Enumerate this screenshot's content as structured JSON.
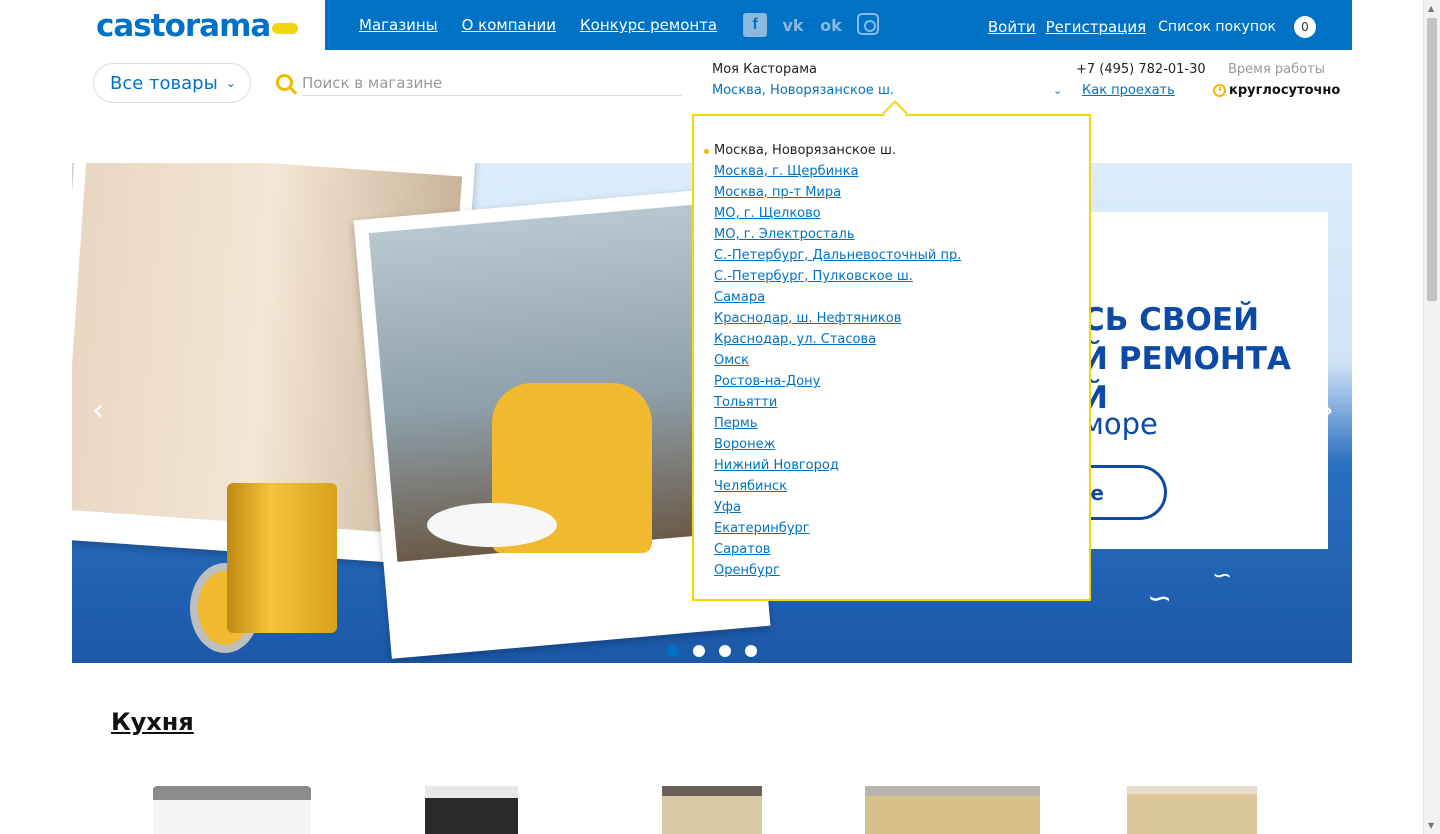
{
  "logo": {
    "text": "castorama"
  },
  "topnav": {
    "items": [
      {
        "label": "Магазины"
      },
      {
        "label": "О компании"
      },
      {
        "label": "Конкурс ремонта"
      }
    ]
  },
  "social": {
    "items": [
      {
        "icon": "facebook-icon",
        "glyph": "f"
      },
      {
        "icon": "vk-icon",
        "glyph": "vk"
      },
      {
        "icon": "odnoklassniki-icon",
        "glyph": "ok"
      },
      {
        "icon": "instagram-icon",
        "glyph": ""
      }
    ]
  },
  "user": {
    "login": "Войти",
    "register": "Регистрация",
    "shopping_list": "Список покупок",
    "cart_count": "0"
  },
  "catalog": {
    "label": "Все товары"
  },
  "search": {
    "placeholder": "Поиск в магазине"
  },
  "store": {
    "label": "Моя Касторама",
    "current": "Москва, Новорязанское ш.",
    "phone": "+7 (495) 782-01-30",
    "directions": "Как проехать",
    "hours_label": "Время работы",
    "hours_value": "круглосуточно"
  },
  "banner": {
    "title_line1": "СЬ СВОЕЙ",
    "title_line2": "Й РЕМОНТА",
    "title_line3": "Й",
    "subtitle": "море",
    "button": "е",
    "slides": 4,
    "active_slide": 1
  },
  "store_dropdown": {
    "current": "Москва, Новорязанское ш.",
    "stores": [
      "Москва, г. Щербинка",
      "Москва, пр-т Мира",
      "МО, г. Щелково",
      "МО, г. Электросталь",
      "С.-Петербург, Дальневосточный пр.",
      "С.-Петербург, Пулковское ш.",
      "Самара",
      "Краснодар, ш. Нефтяников",
      "Краснодар, ул. Стасова",
      "Омск",
      "Ростов-на-Дону",
      "Тольятти",
      "Пермь",
      "Воронеж",
      "Нижний Новгород",
      "Челябинск",
      "Уфа",
      "Екатеринбург",
      "Саратов",
      "Оренбург"
    ]
  },
  "section": {
    "title": "Кухня"
  },
  "colors": {
    "brand_blue": "#0072c5",
    "brand_yellow": "#f5d60d",
    "banner_blue": "#0c4aa6"
  }
}
